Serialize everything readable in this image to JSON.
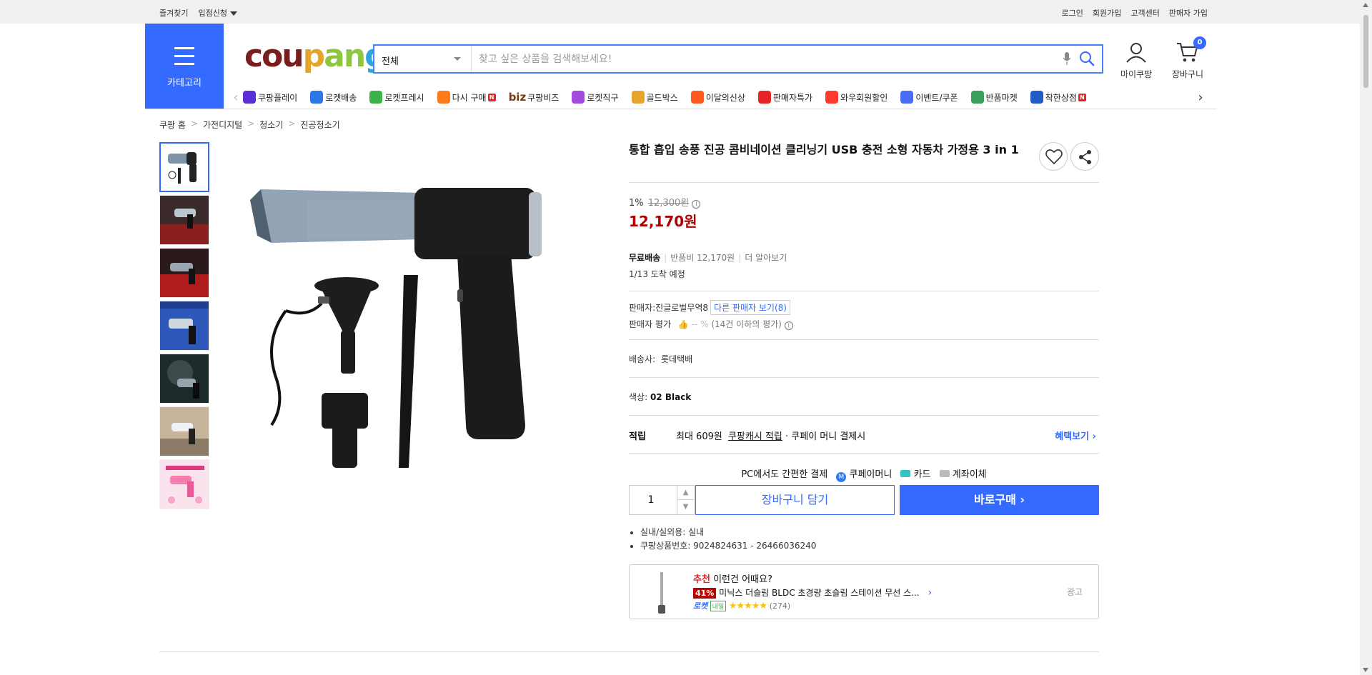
{
  "topbar": {
    "left": [
      "즐겨찾기",
      "입점신청"
    ],
    "right": [
      "로그인",
      "회원가입",
      "고객센터",
      "판매자 가입"
    ]
  },
  "header": {
    "category_label": "카테고리",
    "logo_parts": [
      "cou",
      "p",
      "an",
      "g"
    ],
    "search_category": "전체",
    "search_placeholder": "찾고 싶은 상품을 검색해보세요!",
    "mycoupang_label": "마이쿠팡",
    "cart_label": "장바구니",
    "cart_count": "0"
  },
  "nav": [
    {
      "label": "쿠팡플레이",
      "icon": "play-icon",
      "color": "#5b2fd6"
    },
    {
      "label": "로켓배송",
      "icon": "rocket-icon",
      "color": "#2c77e5"
    },
    {
      "label": "로켓프레시",
      "icon": "rocket-fresh-icon",
      "color": "#3bb34a"
    },
    {
      "label": "다시 구매",
      "icon": "rebuy-icon",
      "color": "#ff7a1a",
      "badge": "N"
    },
    {
      "label": "쿠팡비즈",
      "icon": "biz-icon",
      "color": "#7a3b10",
      "prefix": "biz"
    },
    {
      "label": "로켓직구",
      "icon": "global-icon",
      "color": "#a14be0"
    },
    {
      "label": "골드박스",
      "icon": "goldbox-icon",
      "color": "#e8a42a"
    },
    {
      "label": "이달의신상",
      "icon": "new-icon",
      "color": "#ff5a1f"
    },
    {
      "label": "판매자특가",
      "icon": "sale-icon",
      "color": "#e52528"
    },
    {
      "label": "와우회원할인",
      "icon": "wow-icon",
      "color": "#ff3b30"
    },
    {
      "label": "이벤트/쿠폰",
      "icon": "coupon-icon",
      "color": "#4a6cf7"
    },
    {
      "label": "반품마켓",
      "icon": "return-market-icon",
      "color": "#3b9e5e"
    },
    {
      "label": "착한상점",
      "icon": "good-shop-icon",
      "color": "#1f5cc7",
      "badge": "N"
    }
  ],
  "breadcrumb": [
    "쿠팡 홈",
    "가전디지털",
    "청소기",
    "진공청소기"
  ],
  "product": {
    "title": "통합 흡입 송풍 진공 콤비네이션 클리닝기 USB 충전 소형 자동차 가정용 3 in 1",
    "discount_rate": "1%",
    "original_price": "12,300원",
    "price": "12,170원",
    "shipping_label": "무료배송",
    "return_fee": "반품비 12,170원",
    "more_info": "더 알아보기",
    "arrival": "1/13 도착 예정",
    "seller_label": "판매자:",
    "seller_name": "진글로벌무역8",
    "other_sellers": "다른 판매자 보기(8)",
    "seller_rating_label": "판매자 평가",
    "seller_rating_value": "-- %",
    "seller_rating_note": "(14건 이하의 평가)",
    "courier_label": "배송사:",
    "courier_name": "롯데택배",
    "color_label": "색상:",
    "color_value": "02 Black",
    "reward_label": "적립",
    "reward_amount": "최대 609원",
    "reward_cash": "쿠팡캐시 적립",
    "reward_tail": "· 쿠페이 머니 결제시",
    "benefit_link": "혜택보기",
    "pc_pay_label": "PC에서도 간편한 결제",
    "pay_methods": [
      "쿠페이머니",
      "카드",
      "계좌이체"
    ],
    "quantity": "1",
    "cart_button": "장바구니 담기",
    "buy_button": "바로구매",
    "details": [
      "실내/실외용: 실내",
      "쿠팡상품번호: 9024824631 - 26466036240"
    ]
  },
  "recommendation": {
    "tag": "추천",
    "heading": "이런건 어때요?",
    "discount": "41%",
    "name": "미닉스 더슬림 BLDC 초경량 초슬림 스테이션 무선 스...",
    "delivery_badge": "로켓",
    "delivery_day": "내일",
    "stars": "★★★★★",
    "review_count": "(274)",
    "ad_label": "광고"
  }
}
